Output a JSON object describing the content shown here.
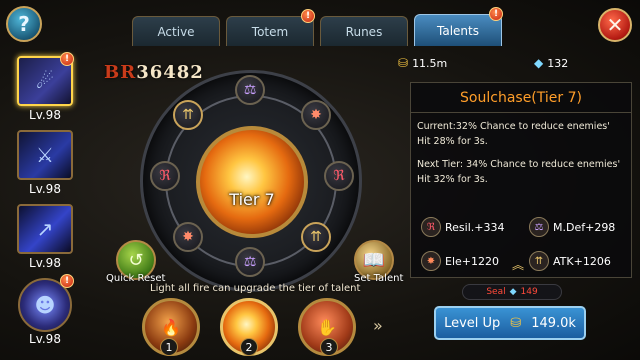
{
  "tabs": [
    {
      "label": "Active",
      "active": false
    },
    {
      "label": "Totem",
      "active": false,
      "badge": "!"
    },
    {
      "label": "Runes",
      "active": false
    },
    {
      "label": "Talents",
      "active": true,
      "badge": "!"
    }
  ],
  "help": {
    "icon": "?"
  },
  "close": {
    "icon": "✕"
  },
  "heroes": [
    {
      "level": "Lv.98",
      "selected": true,
      "badge": "!"
    },
    {
      "level": "Lv.98",
      "selected": false
    },
    {
      "level": "Lv.98",
      "selected": false
    },
    {
      "level": "Lv.98",
      "selected": false,
      "badge": "!"
    }
  ],
  "battle_rating": {
    "prefix": "BR",
    "value": "36482"
  },
  "resources": {
    "gold": "11.5m",
    "gems": "132"
  },
  "core": {
    "label": "Tier 7"
  },
  "buttons": {
    "quick_reset": "Quick Reset",
    "set_talent": "Set Talent",
    "level_up": "Level Up",
    "level_up_cost": "149.0k"
  },
  "hint": "Light all fire can upgrade the tier of talent",
  "tier_orbs": [
    "1",
    "2",
    "3"
  ],
  "chevrons": "»",
  "talent": {
    "title": "Soulchase(Tier 7)",
    "current_line1": "Current:32% Chance to reduce enemies'",
    "current_line2": "Hit 28% for 3s.",
    "next_line1": "Next Tier: 34% Chance to reduce enemies'",
    "next_line2": "Hit 32% for 3s."
  },
  "stats": [
    {
      "label": "Resil.+334"
    },
    {
      "label": "M.Def+298"
    },
    {
      "label": "Ele+1220"
    },
    {
      "label": "ATK+1206"
    }
  ],
  "seal": {
    "label": "Seal",
    "count": "149"
  },
  "colors": {
    "title": "#ff9e2a",
    "accent_blue": "#3a93d4",
    "seal_red": "#ff4a3a"
  }
}
